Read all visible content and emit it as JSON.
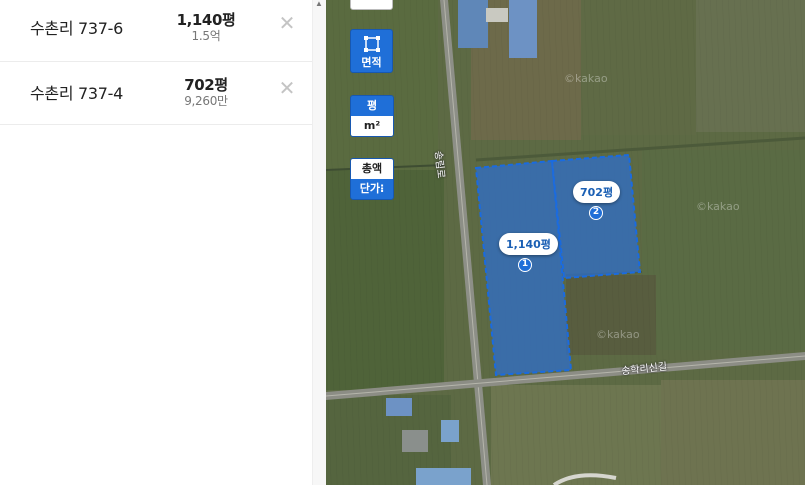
{
  "parcels": [
    {
      "address": "수촌리 737-6",
      "area": "1,140평",
      "price": "1.5억"
    },
    {
      "address": "수촌리 737-4",
      "area": "702평",
      "price": "9,260만"
    }
  ],
  "controls": {
    "area_measure_label": "면적",
    "unit_pyeong": "평",
    "unit_sqm": "m²",
    "total_label": "총액",
    "unit_price_label": "단가"
  },
  "map": {
    "tags": [
      {
        "label": "1,140평",
        "num": "1"
      },
      {
        "label": "702평",
        "num": "2"
      }
    ],
    "road_vertical": "송림로",
    "road_horizontal": "송학리신길",
    "watermark": "©kakao"
  },
  "colors": {
    "accent": "#1f6fd8",
    "parcel_fill": "#2f6fc9",
    "parcel_stroke": "#1a6be0"
  }
}
